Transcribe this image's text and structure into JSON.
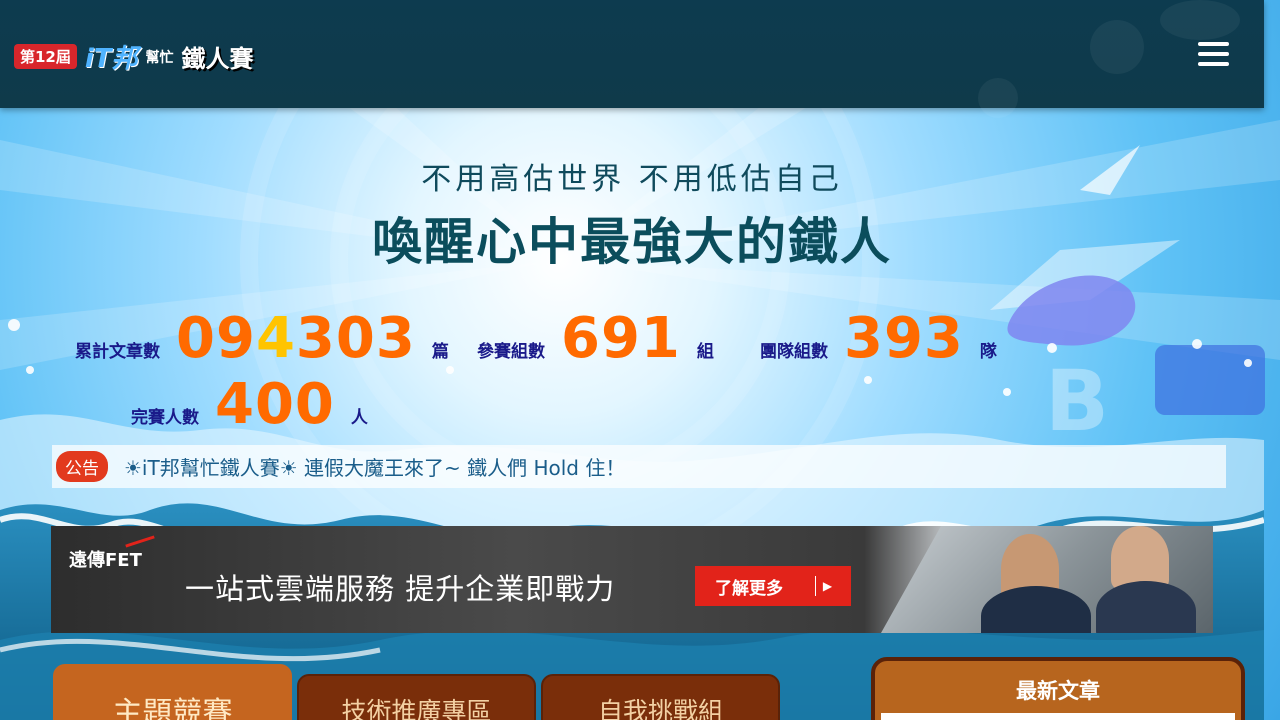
{
  "header": {
    "logo": {
      "edition": "第12屆",
      "brand": "iT邦",
      "help": "幫忙",
      "event": "鐵人賽"
    },
    "menu_icon": "hamburger-icon"
  },
  "hero": {
    "slogan_sub": "不用高估世界 不用低估自己",
    "slogan_main": "喚醒心中最強大的鐵人"
  },
  "stats": {
    "articles": {
      "label": "累計文章數",
      "value_pre": "09",
      "value_hl": "4",
      "value_post": "303",
      "unit": "篇"
    },
    "teams_entered": {
      "label": "參賽組數",
      "value": "691",
      "unit": "組"
    },
    "group_teams": {
      "label": "團隊組數",
      "value": "393",
      "unit": "隊"
    },
    "finishers": {
      "label": "完賽人數",
      "value": "400",
      "unit": "人"
    }
  },
  "announcement": {
    "tag": "公告",
    "text": "☀iT邦幫忙鐵人賽☀ 連假大魔王來了~ 鐵人們 Hold 住！"
  },
  "banner": {
    "brand": "遠傳FET",
    "title": "一站式雲端服務  提升企業即戰力",
    "button_label": "了解更多",
    "button_arrow": "▶"
  },
  "tabs": [
    {
      "label": "主題競賽",
      "active": true
    },
    {
      "label": "技術推廣專區",
      "active": false
    },
    {
      "label": "自我挑戰組",
      "active": false
    }
  ],
  "latest": {
    "title": "最新文章"
  },
  "colors": {
    "header_bg": "#0f3a4a",
    "stat_number": "#ff6a00",
    "stat_highlight": "#ffc400",
    "stat_label": "#1a1a8a",
    "announce_tag": "#e23a1e",
    "tab_active": "#c5651f",
    "tab_inactive": "#7a2e0a",
    "banner_button": "#e2231a"
  }
}
